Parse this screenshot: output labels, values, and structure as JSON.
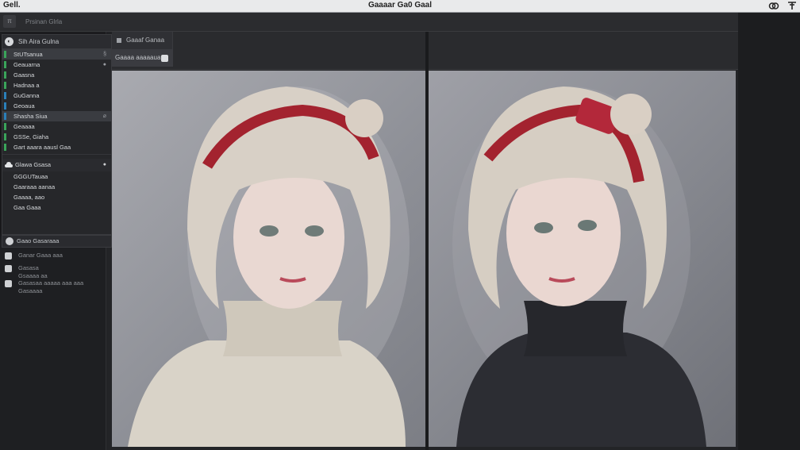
{
  "window": {
    "app_label": "Gell.",
    "title": "Gaaaar Ga0 Gaal"
  },
  "topbar": {
    "grip_label": "π",
    "breadcrumb": "Prsinan Glrla"
  },
  "panel": {
    "header": "Sih Aira Gulna",
    "rows": [
      {
        "label": "StUTsanua",
        "selected": true,
        "side": "§",
        "mark_color": "#3aa45a"
      },
      {
        "label": "Geauarna",
        "selected": false,
        "side": "●",
        "mark_color": "#3aa45a"
      },
      {
        "label": "Gaasna",
        "selected": false,
        "side": "",
        "mark_color": "#3aa45a"
      },
      {
        "label": "Hadnaa a",
        "selected": false,
        "side": "",
        "mark_color": "#3aa45a"
      },
      {
        "label": "GuGanna",
        "selected": false,
        "side": "",
        "mark_color": "#2b7fb8"
      },
      {
        "label": "Geoaua",
        "selected": false,
        "side": "",
        "mark_color": "#2b7fb8"
      },
      {
        "label": "Shasha Siua",
        "selected": true,
        "side": "⌀",
        "mark_color": "#2b7fb8"
      },
      {
        "label": "Geaaaa",
        "selected": false,
        "side": "",
        "mark_color": "#3aa45a"
      },
      {
        "label": "GSSe, Giaha",
        "selected": false,
        "side": "",
        "mark_color": "#3aa45a"
      },
      {
        "label": "Gart aaara aausl Gaa",
        "selected": false,
        "side": "",
        "mark_color": "#3aa45a"
      }
    ],
    "section": {
      "header": "Glawa Gsasa",
      "side": "●",
      "rows": [
        {
          "label": "GGGUTauaa"
        },
        {
          "label": "Gaaraaa aanaa"
        },
        {
          "label": "Gaaaa, aao"
        },
        {
          "label": "Gaa Gaaa"
        }
      ]
    },
    "footer": "Gaao Gasaraaa"
  },
  "rail": {
    "items": [
      {
        "label": "Ganar Gaaa aaa"
      },
      {
        "label": "Gasasa\nGsaaaa aa"
      },
      {
        "label": "Gasasaa aaaaa aaa aaa\nGasaaaa"
      }
    ]
  },
  "viewer": {
    "tab_a": "Gaaaf Ganaa",
    "tab_b": "Gaaaa aaaaaua"
  },
  "images": {
    "left": {
      "description_icon": "portrait-image",
      "sweater": "#d9d3c8"
    },
    "right": {
      "description_icon": "portrait-image",
      "sweater": "#2c2d33"
    }
  }
}
